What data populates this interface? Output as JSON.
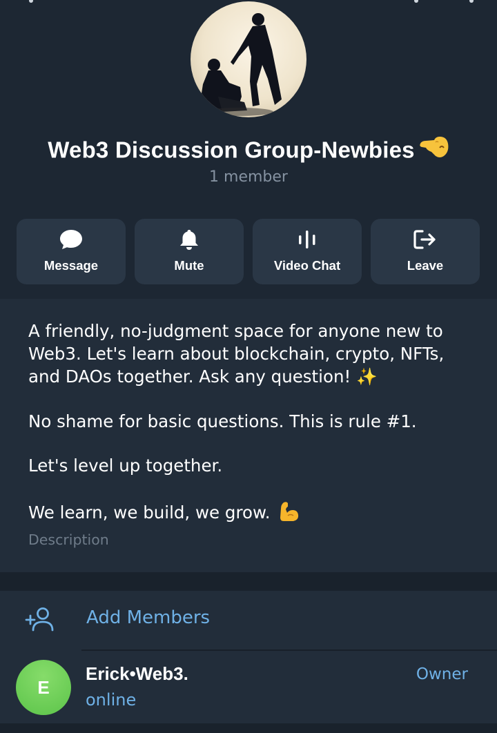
{
  "group": {
    "title": "Web3 Discussion Group-Newbies",
    "title_emoji": "hand-pointing-emoji",
    "member_count": "1 member"
  },
  "actions": [
    {
      "label": "Message",
      "icon": "chat-bubble-icon"
    },
    {
      "label": "Mute",
      "icon": "bell-icon"
    },
    {
      "label": "Video Chat",
      "icon": "audio-bars-icon"
    },
    {
      "label": "Leave",
      "icon": "logout-icon"
    }
  ],
  "description": {
    "lines": [
      "A friendly, no-judgment space for anyone new to",
      "Web3. Let's learn about blockchain, crypto, NFTs,",
      "and DAOs together. Ask any question! ✨",
      "No shame for basic questions. This is rule #1.",
      "Let's  level up together.",
      "We learn, we build, we grow."
    ],
    "label": "Description"
  },
  "members": {
    "add_label": "Add Members",
    "list": [
      {
        "initial": "E",
        "name": "Erick•Web3.",
        "status": "online",
        "role": "Owner"
      }
    ]
  },
  "colors": {
    "background": "#1d2733",
    "panel": "#222d3a",
    "button": "#2a3746",
    "accent": "#6fb1e6",
    "muted_text": "#8592a1",
    "avatar_green": "#5cc44a"
  }
}
